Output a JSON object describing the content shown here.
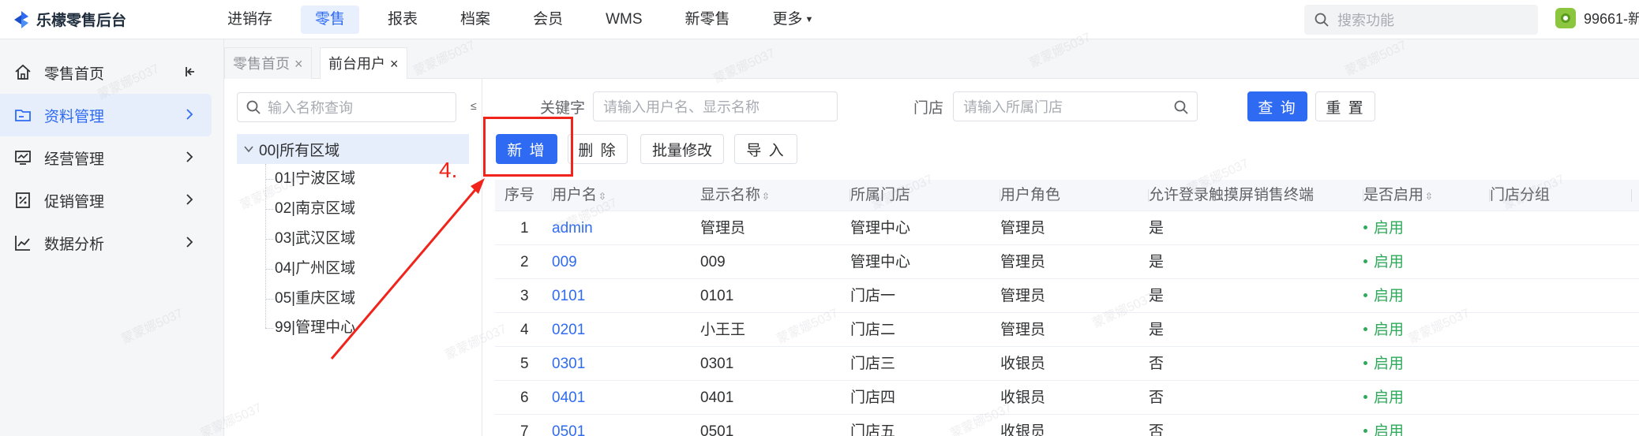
{
  "app": {
    "logo_text": "乐檬零售后台"
  },
  "nav": {
    "items": [
      "进销存",
      "零售",
      "报表",
      "档案",
      "会员",
      "WMS",
      "新零售",
      "更多"
    ],
    "active_index": 1
  },
  "top_search": {
    "placeholder": "搜索功能"
  },
  "user": {
    "name": "99661-新"
  },
  "sidebar": {
    "items": [
      {
        "label": "零售首页",
        "icon": "home-icon"
      },
      {
        "label": "资料管理",
        "icon": "folder-icon"
      },
      {
        "label": "经营管理",
        "icon": "monitor-chart-icon"
      },
      {
        "label": "促销管理",
        "icon": "promotion-icon"
      },
      {
        "label": "数据分析",
        "icon": "line-chart-icon"
      }
    ],
    "active_index": 1
  },
  "tabs": [
    {
      "label": "零售首页",
      "active": false
    },
    {
      "label": "前台用户",
      "active": true
    }
  ],
  "tree": {
    "search_placeholder": "输入名称查询",
    "root": "00|所有区域",
    "children": [
      "01|宁波区域",
      "02|南京区域",
      "03|武汉区域",
      "04|广州区域",
      "05|重庆区域",
      "99|管理中心"
    ]
  },
  "filters": {
    "keyword_label": "关键字",
    "keyword_placeholder": "请输入用户名、显示名称",
    "store_label": "门店",
    "store_placeholder": "请输入所属门店",
    "query_button": "查 询",
    "reset_button": "重 置"
  },
  "actions": {
    "add": "新 增",
    "delete": "删 除",
    "batch_edit": "批量修改",
    "import": "导 入"
  },
  "annotation": {
    "label": "4."
  },
  "table": {
    "columns": [
      "序号",
      "用户名",
      "显示名称",
      "所属门店",
      "用户角色",
      "允许登录触摸屏销售终端",
      "是否启用",
      "门店分组"
    ],
    "rows": [
      {
        "no": "1",
        "username": "admin",
        "display": "管理员",
        "store": "管理中心",
        "role": "管理员",
        "touch": "是",
        "enabled": "启用"
      },
      {
        "no": "2",
        "username": "009",
        "display": "009",
        "store": "管理中心",
        "role": "管理员",
        "touch": "是",
        "enabled": "启用"
      },
      {
        "no": "3",
        "username": "0101",
        "display": "0101",
        "store": "门店一",
        "role": "管理员",
        "touch": "是",
        "enabled": "启用"
      },
      {
        "no": "4",
        "username": "0201",
        "display": "小王王",
        "store": "门店二",
        "role": "管理员",
        "touch": "是",
        "enabled": "启用"
      },
      {
        "no": "5",
        "username": "0301",
        "display": "0301",
        "store": "门店三",
        "role": "收银员",
        "touch": "否",
        "enabled": "启用"
      },
      {
        "no": "6",
        "username": "0401",
        "display": "0401",
        "store": "门店四",
        "role": "收银员",
        "touch": "否",
        "enabled": "启用"
      },
      {
        "no": "7",
        "username": "0501",
        "display": "0501",
        "store": "门店五",
        "role": "收银员",
        "touch": "否",
        "enabled": "启用"
      }
    ]
  },
  "watermark": "蒙蒙娜5037",
  "colors": {
    "primary": "#2f6bf2",
    "success": "#2faa5a",
    "annotation": "#f0241b"
  }
}
